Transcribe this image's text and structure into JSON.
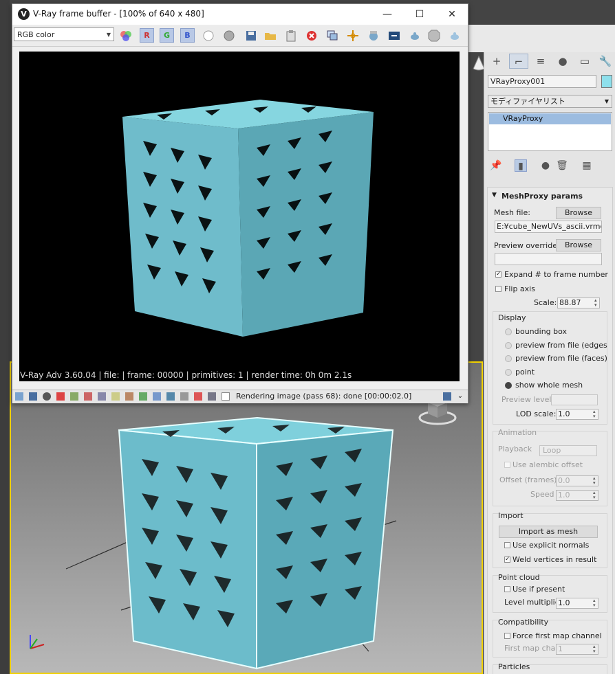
{
  "vfb": {
    "title": "V-Ray frame buffer - [100% of 640 x 480]",
    "logo": "V",
    "window_buttons": [
      "—",
      "☐",
      "✕"
    ],
    "channel": "RGB color",
    "rgb_buttons": [
      "R",
      "G",
      "B"
    ],
    "render_status": "V-Ray Adv 3.60.04 | file:  | frame: 00000 | primitives: 1 | render time:  0h  0m  2.1s",
    "statusbar_text": "Rendering image (pass 68): done [00:00:02.0]"
  },
  "panel": {
    "tabs": [
      "+",
      "⌐",
      "≡",
      "●",
      "▭",
      "🔧"
    ],
    "object_name": "VRayProxy001",
    "modifier_list": "モディファイヤリスト",
    "stack_item": "VRayProxy",
    "rollout_title": "MeshProxy params",
    "mesh_file_label": "Mesh file:",
    "browse_label": "Browse",
    "mesh_file_path": "E:¥cube_NewUVs_ascii.vrmesh",
    "preview_override_label": "Preview override:",
    "preview_override_browse": "Browse",
    "expand_label": "Expand # to frame number",
    "flip_axis_label": "Flip axis",
    "scale_label": "Scale:",
    "scale_value": "88.87",
    "display": {
      "title": "Display",
      "options": [
        "bounding box",
        "preview from file (edges",
        "preview from file (faces)",
        "point",
        "show whole mesh"
      ],
      "preview_level_label": "Preview level:",
      "lod_label": "LOD scale:",
      "lod_value": "1.0"
    },
    "animation": {
      "title": "Animation",
      "playback_label": "Playback",
      "playback_value": "Loop",
      "alembic_label": "Use alembic offset",
      "offset_label": "Offset (frames)",
      "offset_value": "0.0",
      "speed_label": "Speed",
      "speed_value": "1.0"
    },
    "import": {
      "title": "Import",
      "import_button": "Import as mesh",
      "explicit_normals": "Use explicit normals",
      "weld": "Weld vertices in result"
    },
    "point_cloud": {
      "title": "Point cloud",
      "use_if_present": "Use if present",
      "level_label": "Level multiplier",
      "level_value": "1.0"
    },
    "compat": {
      "title": "Compatibility",
      "force_first": "Force first map channel",
      "first_map_label": "First map chan",
      "first_map_value": "1"
    },
    "particles_title": "Particles"
  },
  "colors": {
    "viewport_border": "#f0d000",
    "mesh_color": "#8ee0ec",
    "selection_highlight": "#9cbce0"
  }
}
